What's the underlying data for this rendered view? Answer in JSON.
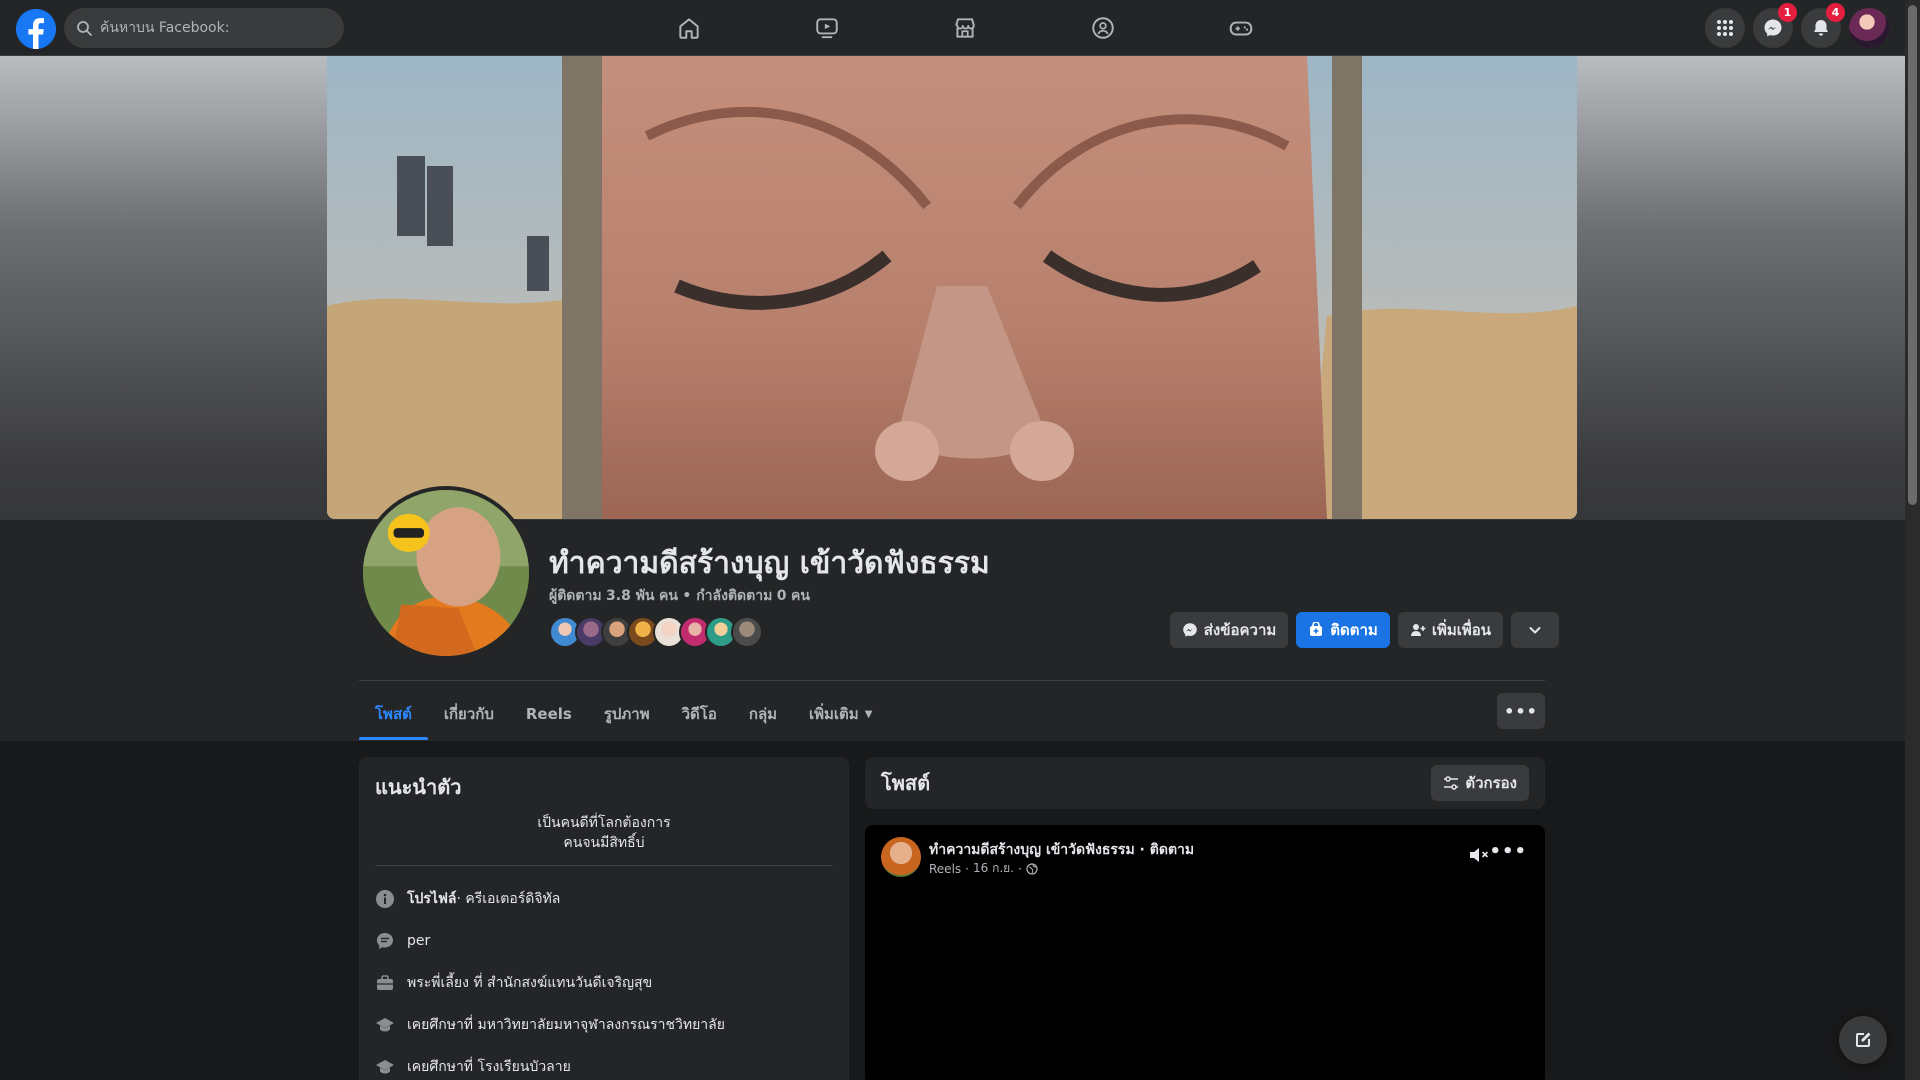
{
  "topbar": {
    "search_placeholder": "ค้นหาบน Facebook:",
    "nav": [
      {
        "icon": "home-icon"
      },
      {
        "icon": "video-icon"
      },
      {
        "icon": "marketplace-icon"
      },
      {
        "icon": "groups-icon"
      },
      {
        "icon": "gaming-icon"
      }
    ],
    "messenger_badge": "1",
    "notifications_badge": "4"
  },
  "profile": {
    "name": "ทำความดีสร้างบุญ เข้าวัดฟังธรรม",
    "followers_label": "ผู้ติดตาม",
    "followers_count": "3.8 พัน",
    "followers_unit": "คน",
    "following_label": "กำลังติดตาม",
    "following_count": "0",
    "following_unit": "คน",
    "buttons": {
      "message": "ส่งข้อความ",
      "follow": "ติดตาม",
      "add_friend": "เพิ่มเพื่อน"
    }
  },
  "tabs": [
    {
      "label": "โพสต์",
      "active": true
    },
    {
      "label": "เกี่ยวกับ"
    },
    {
      "label": "Reels"
    },
    {
      "label": "รูปภาพ"
    },
    {
      "label": "วิดีโอ"
    },
    {
      "label": "กลุ่ม"
    },
    {
      "label": "เพิ่มเติม"
    }
  ],
  "intro": {
    "title": "แนะนำตัว",
    "bio_line1": "เป็นคนดีที่โลกต้องการ",
    "bio_line2": "คนจนมีสิทธิ์บ่",
    "rows": [
      {
        "icon": "info-icon",
        "bold": "โปรไฟล์",
        "text": " · ครีเอเตอร์ดิจิทัล"
      },
      {
        "icon": "chat-icon",
        "bold": "",
        "text": "per"
      },
      {
        "icon": "briefcase-icon",
        "bold": "",
        "text": "พระพี่เลี้ยง ที่ สำนักสงฆ์แทนวันดีเจริญสุข"
      },
      {
        "icon": "education-icon",
        "bold": "",
        "text": "เคยศึกษาที่ มหาวิทยาลัยมหาจุฬาลงกรณราชวิทยาลัย"
      },
      {
        "icon": "education-icon",
        "bold": "",
        "text": "เคยศึกษาที่ โรงเรียนบัวลาย"
      }
    ]
  },
  "posts": {
    "title": "โพสต์",
    "filter_label": "ตัวกรอง"
  },
  "post": {
    "author": "ทำความดีสร้างบุญ เข้าวัดฟังธรรม",
    "follow_suffix": " · ติดตาม",
    "type": "Reels",
    "date": "16 ก.ย.",
    "privacy_icon": "globe-icon"
  },
  "colors": {
    "accent": "#1b74e4",
    "active_tab": "#2d88ff",
    "badge": "#e41e3f",
    "card": "#242526",
    "background": "#18191a"
  }
}
